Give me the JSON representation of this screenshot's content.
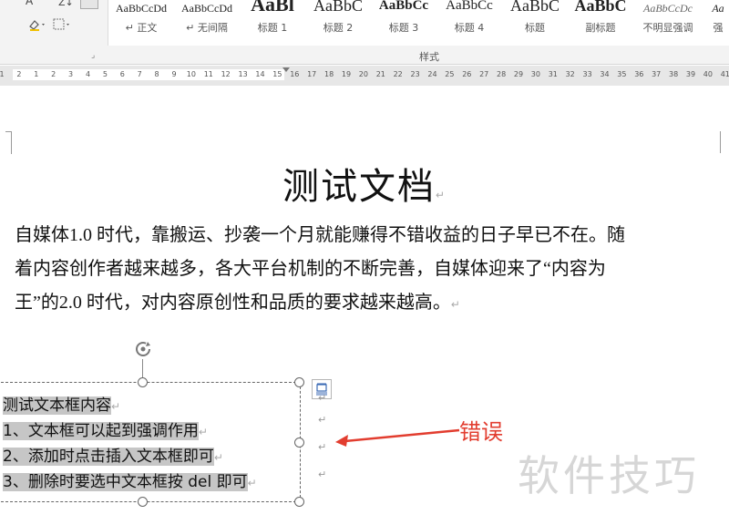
{
  "ribbon": {
    "font_btn": "A",
    "sort_btn": "Z↓",
    "styles_group_label": "样式",
    "styles": [
      {
        "preview": "AaBbCcDd",
        "label": "↵ 正文"
      },
      {
        "preview": "AaBbCcDd",
        "label": "↵ 无间隔"
      },
      {
        "preview": "AaBl",
        "label": "标题 1"
      },
      {
        "preview": "AaBbC",
        "label": "标题 2"
      },
      {
        "preview": "AaBbCc",
        "label": "标题 3"
      },
      {
        "preview": "AaBbCc",
        "label": "标题 4"
      },
      {
        "preview": "AaBbC",
        "label": "标题"
      },
      {
        "preview": "AaBbC",
        "label": "副标题"
      },
      {
        "preview": "AaBbCcDc",
        "label": "不明显强调"
      },
      {
        "preview": "Aa",
        "label": "强"
      }
    ]
  },
  "ruler": {
    "numbers": [
      "1",
      "2",
      "1",
      "2",
      "3",
      "4",
      "5",
      "6",
      "7",
      "8",
      "9",
      "10",
      "11",
      "12",
      "13",
      "14",
      "15",
      "16",
      "17",
      "18",
      "19",
      "20",
      "21",
      "22",
      "23",
      "24",
      "25",
      "26",
      "27",
      "28",
      "29",
      "30",
      "31",
      "32",
      "33",
      "34",
      "35",
      "36",
      "37",
      "38",
      "39",
      "40",
      "41"
    ]
  },
  "document": {
    "title": "测试文档",
    "paragraph_lines": [
      "自媒体1.0 时代，靠搬运、抄袭一个月就能赚得不错收益的日子早已不在。随",
      "着内容创作者越来越多，各大平台机制的不断完善，自媒体迎来了“内容为",
      "王”的2.0 时代，对内容原创性和品质的要求越来越高。"
    ],
    "paragraph_mark": "↵",
    "textbox_lines": [
      "测试文本框内容",
      "1、文本框可以起到强调作用",
      "2、添加时点击插入文本框即可",
      "3、删除时要选中文本框按 del 即可"
    ]
  },
  "annotation": {
    "error_label": "错误",
    "watermark": "软件技巧",
    "color": "#e23d2f"
  }
}
